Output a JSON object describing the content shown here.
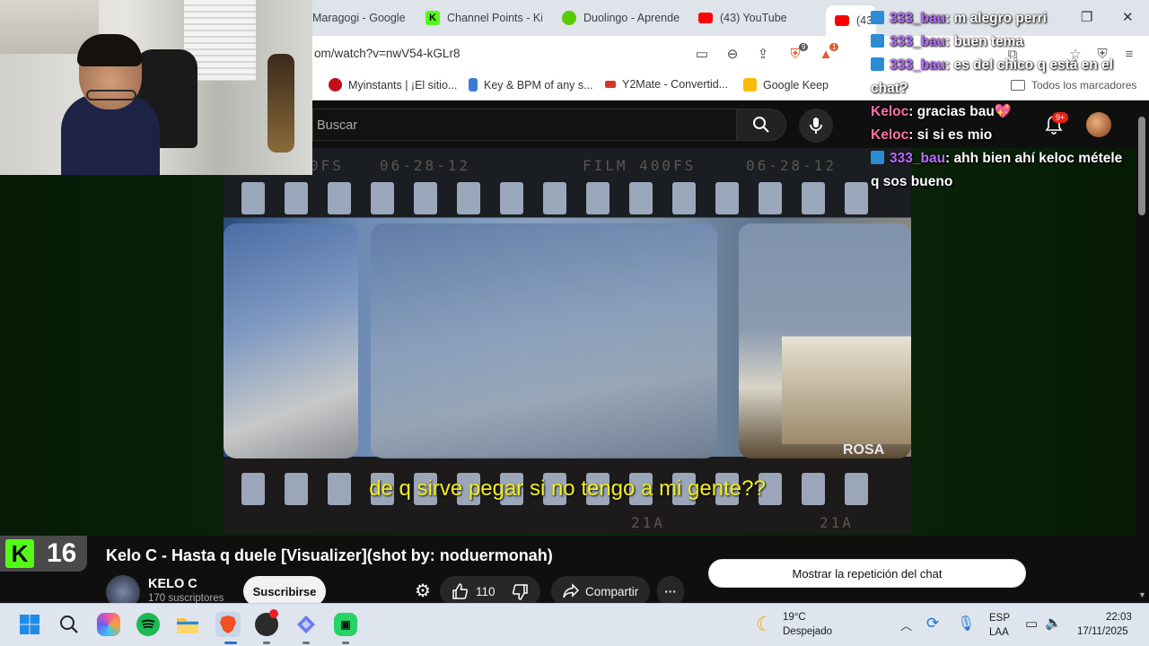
{
  "browser": {
    "tabs": [
      {
        "label": "Maragogi - Google",
        "icon": "google-icon",
        "color": "#dfe3ea"
      },
      {
        "label": "Channel Points - Ki",
        "icon": "kick-icon",
        "color": "#53fc18"
      },
      {
        "label": "Duolingo - Aprende",
        "icon": "duolingo-icon",
        "color": "#58cc02"
      },
      {
        "label": "(43) YouTube",
        "icon": "youtube-icon",
        "color": "#ff0000"
      },
      {
        "label": "(43",
        "icon": "youtube-icon",
        "color": "#ff0000"
      }
    ],
    "url": "om/watch?v=nwV54-kGLr8",
    "shield_count": "9",
    "alert_count": "1",
    "bookmarks": [
      {
        "label": "Myinstants | ¡El sitio...",
        "icon": "myinstants-icon"
      },
      {
        "label": "Key & BPM of any s...",
        "icon": "tunebat-icon"
      },
      {
        "label": "Y2Mate - Convertid...",
        "icon": "y2mate-icon"
      },
      {
        "label": "Google Keep",
        "icon": "keep-icon"
      }
    ],
    "bookmarks_all": "Todos los marcadores"
  },
  "youtube": {
    "search_placeholder": "Buscar",
    "notification_count": "9+",
    "video": {
      "film_text_left": "0FS",
      "film_date_1": "06-28-12",
      "film_brand": "FILM 400FS",
      "film_date_2": "06-28-12",
      "subtitle": "de q sirve pegar si no tengo a mi gente??",
      "film_bottom": "21A",
      "sign_text": "ROSA"
    },
    "title": "Kelo C - Hasta q duele [Visualizer](shot by: noduermonah)",
    "channel_name": "KELO C",
    "subscribers": "170 suscriptores",
    "subscribe_label": "Suscribirse",
    "likes": "110",
    "share_label": "Compartir",
    "more_label": "···",
    "replay_chat_label": "Mostrar la repetición del chat"
  },
  "kick_overlay": {
    "viewer_count": "16",
    "logo_letter": "K"
  },
  "chat": [
    {
      "user": "333_bau",
      "color": "#b76bff",
      "text": ": m alegro perri",
      "kick_badge": true
    },
    {
      "user": "333_bau",
      "color": "#b76bff",
      "text": ": buen tema",
      "kick_badge": true
    },
    {
      "user": "333_bau",
      "color": "#b76bff",
      "text": ": es del chico q está en el",
      "kick_badge": true
    },
    {
      "user": "",
      "color": "#ffffff",
      "text": "chat?",
      "kick_badge": false
    },
    {
      "user": "Keloc",
      "color": "#ff6fa8",
      "text": ": gracias bau💖",
      "kick_badge": false
    },
    {
      "user": "Keloc",
      "color": "#ff6fa8",
      "text": ": si si es mio",
      "kick_badge": false
    },
    {
      "user": "333_bau",
      "color": "#b76bff",
      "text": ": ahh bien ahí keloc métele",
      "kick_badge": true
    },
    {
      "user": "",
      "color": "#ffffff",
      "text": "q sos bueno",
      "kick_badge": false
    }
  ],
  "taskbar": {
    "weather_temp": "19°C",
    "weather_desc": "Despejado",
    "lang_1": "ESP",
    "lang_2": "LAA",
    "time": "22:03",
    "date": "17/11/2025",
    "apps": [
      "windows-start-icon",
      "search-icon",
      "copilot-icon",
      "spotify-icon",
      "file-explorer-icon",
      "brave-icon",
      "obs-icon",
      "app-icon",
      "whatsapp-icon"
    ]
  }
}
